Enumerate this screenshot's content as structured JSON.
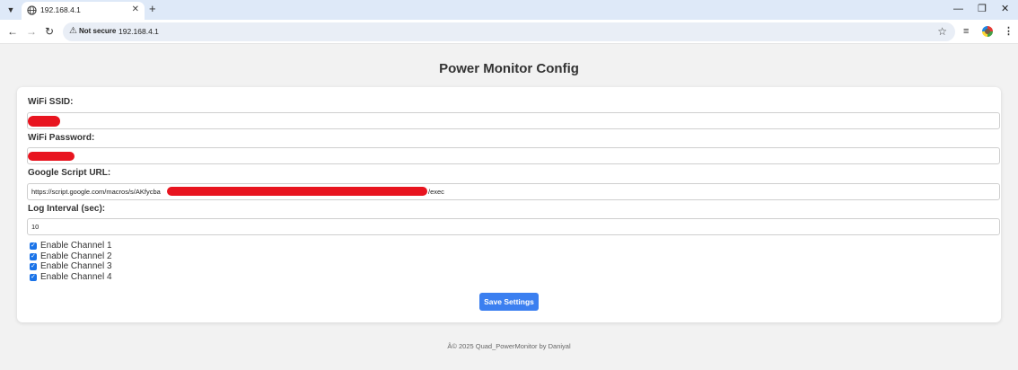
{
  "browser": {
    "tab_title": "192.168.4.1",
    "tab_close": "✕",
    "new_tab": "+",
    "security_label": "Not secure",
    "url": "192.168.4.1",
    "icons": {
      "back": "arrow-left-icon",
      "forward": "arrow-right-icon",
      "reload": "reload-icon",
      "warning": "warning-icon",
      "bookmark": "star-icon",
      "media": "media-queue-icon",
      "menu": "kebab-menu-icon"
    },
    "window_controls": {
      "minimize": "—",
      "restore": "❐",
      "close": "✕"
    }
  },
  "page": {
    "title": "Power Monitor Config",
    "fields": {
      "ssid_label": "WiFi SSID:",
      "password_label": "WiFi Password:",
      "script_url_label": "Google Script URL:",
      "script_url_prefix": "https://script.google.com/macros/s/AKfycba",
      "script_url_suffix": "/exec",
      "interval_label": "Log Interval (sec):",
      "interval_value": "10"
    },
    "channels": [
      {
        "label": "Enable Channel 1",
        "checked": true
      },
      {
        "label": "Enable Channel 2",
        "checked": true
      },
      {
        "label": "Enable Channel 3",
        "checked": true
      },
      {
        "label": "Enable Channel 4",
        "checked": true
      }
    ],
    "save_label": "Save Settings",
    "footer": "Â© 2025 Quad_PowerMonitor by Daniyal"
  },
  "colors": {
    "accent": "#3b7ff0",
    "checkbox": "#1a73e8",
    "redaction": "#e8141f",
    "tabbar": "#dee9f8",
    "page_bg": "#f2f2f2"
  }
}
